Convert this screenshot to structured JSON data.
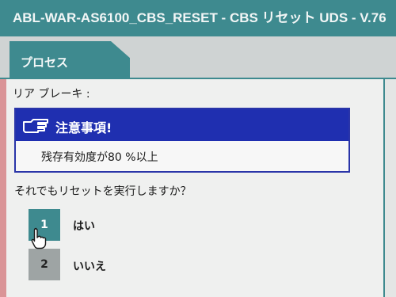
{
  "window": {
    "title": "ABL-WAR-AS6100_CBS_RESET - CBS リセット UDS - V.76"
  },
  "tabs": [
    {
      "label": "プロセス",
      "active": true
    }
  ],
  "section": {
    "label": "リア ブレーキ :"
  },
  "notice": {
    "icon": "pointing-hand-icon",
    "title": "注意事項!",
    "body": "残存有効度が80 %以上"
  },
  "question": "それでもリセットを実行しますか？",
  "options": [
    {
      "number": "1",
      "label": "はい"
    },
    {
      "number": "2",
      "label": "いいえ"
    }
  ],
  "colors": {
    "accent": "#3e8a8f",
    "notice_header": "#1f2fb0",
    "pane_background": "#eff0ef"
  }
}
